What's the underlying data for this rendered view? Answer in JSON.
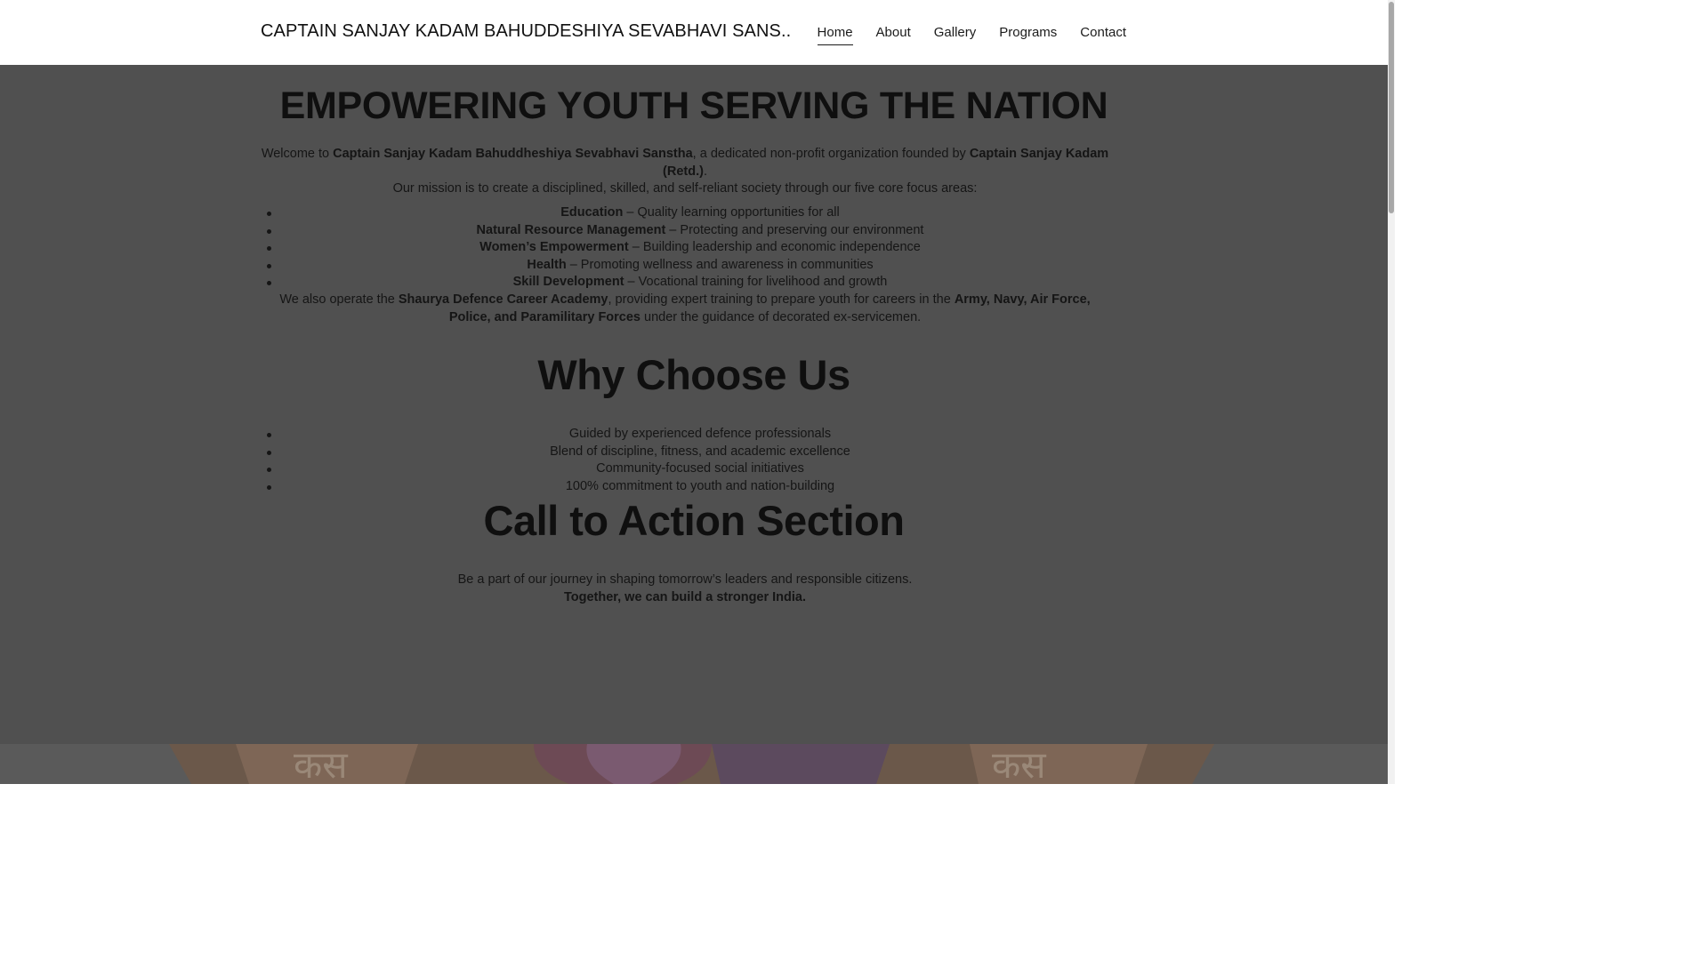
{
  "header": {
    "site_title": "CAPTAIN SANJAY KADAM BAHUDDESHIYA SEVABHAVI SANS..",
    "nav": [
      {
        "label": "Home",
        "active": true
      },
      {
        "label": "About",
        "active": false
      },
      {
        "label": "Gallery",
        "active": false
      },
      {
        "label": "Programs",
        "active": false
      },
      {
        "label": "Contact",
        "active": false
      }
    ]
  },
  "intro": {
    "heading": "EMPOWERING YOUTH SERVING THE NATION",
    "welcome_prefix": "Welcome to ",
    "org_name": "Captain Sanjay Kadam Bahuddheshiya Sevabhavi Sanstha",
    "welcome_middle": ", a dedicated non-profit organization founded by ",
    "founder": "Captain Sanjay Kadam (Retd.)",
    "welcome_suffix": ".",
    "mission": "Our mission is to create a disciplined, skilled, and self-reliant society through our five core focus areas:",
    "focus_areas": [
      {
        "title": "Education",
        "desc": " – Quality learning opportunities for all"
      },
      {
        "title": "Natural Resource Management",
        "desc": " – Protecting and preserving our environment"
      },
      {
        "title": "Women’s Empowerment",
        "desc": " – Building leadership and economic independence"
      },
      {
        "title": "Health",
        "desc": " – Promoting wellness and awareness in communities"
      },
      {
        "title": "Skill Development",
        "desc": " – Vocational training for livelihood and growth"
      }
    ],
    "academy_prefix": "We also operate the ",
    "academy_name": "Shaurya Defence Career Academy",
    "academy_middle": ", providing expert training to prepare youth for careers in the ",
    "forces": "Army, Navy, Air Force, Police, and Paramilitary Forces",
    "academy_suffix": " under the guidance of decorated ex-servicemen."
  },
  "why_choose": {
    "heading": "Why Choose Us",
    "points": [
      "Guided by experienced defence professionals",
      "Blend of discipline, fitness, and academic excellence",
      "Community-focused social initiatives",
      "100% commitment to youth and nation-building"
    ]
  },
  "cta": {
    "heading": "Call to Action Section",
    "line1": "Be a part of our journey in shaping tomorrow’s leaders and responsible citizens.",
    "line2": "Together, we can build a stronger India."
  },
  "colors": {
    "header_bg": "#ffffff",
    "content_bg": "#505050",
    "text": "#111111"
  }
}
